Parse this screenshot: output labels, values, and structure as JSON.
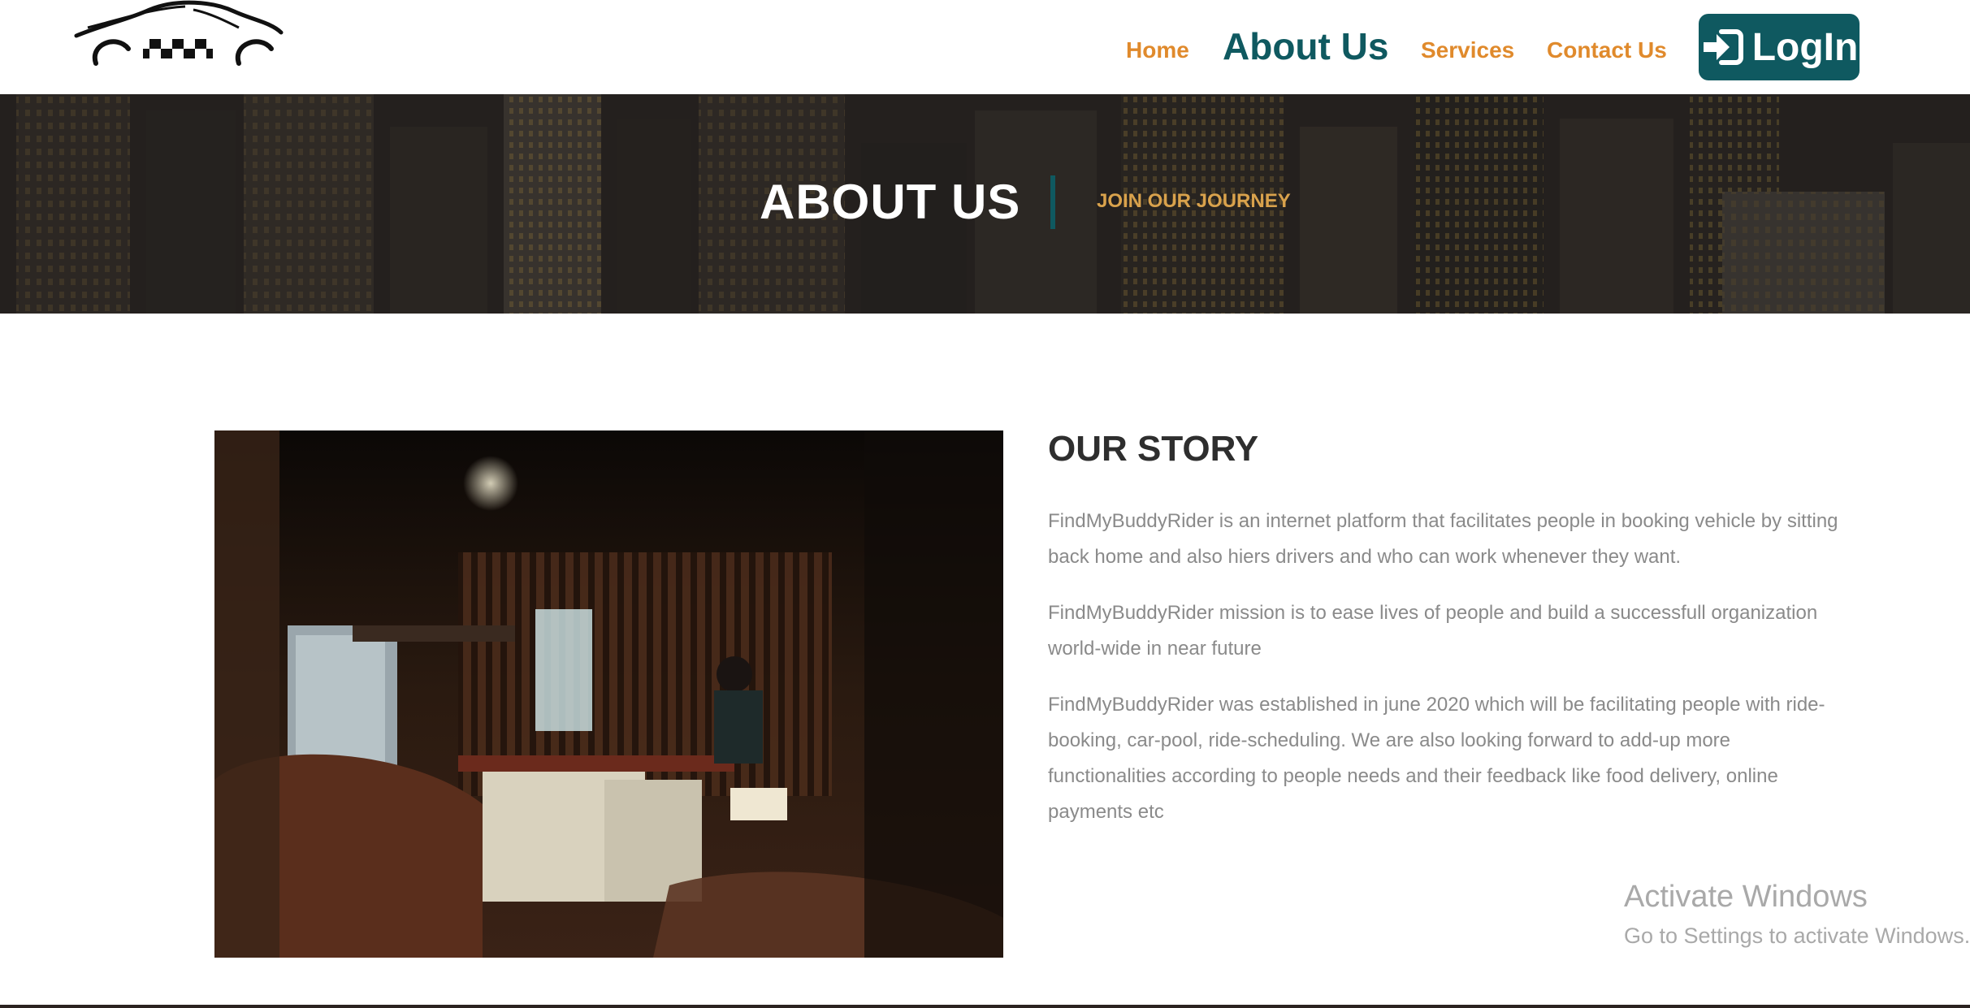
{
  "nav": {
    "items": [
      {
        "label": "Home"
      },
      {
        "label": "About Us",
        "active": true
      },
      {
        "label": "Services"
      },
      {
        "label": "Contact Us"
      }
    ],
    "login_label": "LogIn",
    "login_icon": "sign-in-icon",
    "logo_icon": "taxi-car-logo-icon"
  },
  "hero": {
    "title": "ABOUT US",
    "subtitle": "JOIN OUR JOURNEY"
  },
  "story": {
    "title": "OUR STORY",
    "paragraphs": [
      "FindMyBuddyRider is an internet platform that facilitates people in booking vehicle by sitting back home and also hiers drivers and who can work whenever they want.",
      "FindMyBuddyRider mission is to ease lives of people and build a successfull organization world-wide in near future",
      "FindMyBuddyRider was established in june 2020 which will be facilitating people with ride-booking, car-pool, ride-scheduling. We are also looking forward to add-up more functionalities according to people needs and their feedback like food delivery, online payments etc"
    ]
  },
  "watermark": {
    "title": "Activate Windows",
    "subtitle": "Go to Settings to activate Windows."
  },
  "colors": {
    "brand_teal": "#0f5960",
    "nav_orange": "#e08a2c",
    "hero_accent": "#d9a24c",
    "body_text": "#8a8a8a",
    "heading_text": "#2e2e2e"
  }
}
